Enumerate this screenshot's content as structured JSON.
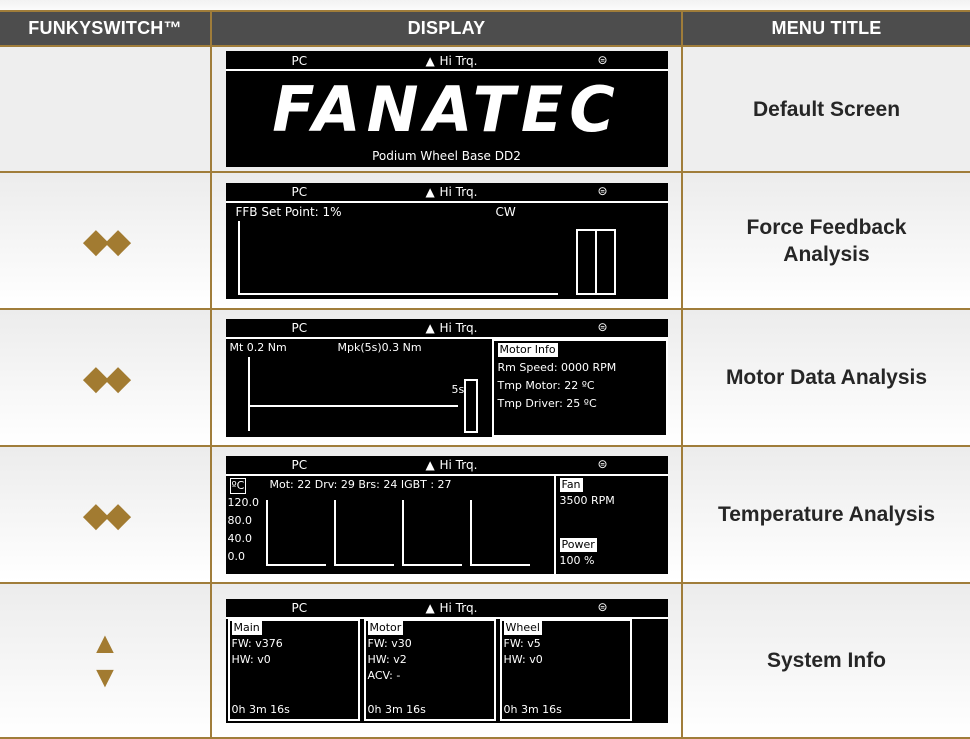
{
  "headers": {
    "funkyswitch": "FUNKYSWITCH™",
    "display": "DISPLAY",
    "menu_title": "MENU TITLE"
  },
  "rows": [
    {
      "control": "",
      "title": "Default Screen",
      "screen": {
        "mode": "PC",
        "trq": "Hi Trq.",
        "logo": "FANATEC",
        "subtitle": "Podium Wheel Base DD2"
      }
    },
    {
      "control": "left-right-arrows",
      "title": "Force Feedback Analysis",
      "screen": {
        "mode": "PC",
        "trq": "Hi Trq.",
        "set_point": "FFB Set Point:  1%",
        "cw": "CW"
      }
    },
    {
      "control": "left-right-arrows",
      "title": "Motor Data Analysis",
      "screen": {
        "mode": "PC",
        "trq": "Hi Trq.",
        "mt": "Mt 0.2 Nm",
        "mpk": "Mpk(5s)0.3 Nm",
        "slider_label": "5s",
        "heading": "Motor Info",
        "rpm": "Rm Speed:  0000 RPM",
        "tmp_motor": "Tmp Motor:  22 ºC",
        "tmp_driver": "Tmp Driver:  25 ºC"
      }
    },
    {
      "control": "left-right-arrows",
      "title": "Temperature Analysis",
      "screen": {
        "mode": "PC",
        "trq": "Hi Trq.",
        "unit": "ºC",
        "temps": "Mot: 22   Drv: 29   Brs: 24   IGBT : 27",
        "y_ticks": [
          "120.0",
          "80.0",
          "40.0",
          "0.0"
        ],
        "fan_label": "Fan",
        "fan_value": "3500 RPM",
        "power_label": "Power",
        "power_value": "100 %"
      }
    },
    {
      "control": "up-down-arrows",
      "title": "System Info",
      "screen": {
        "mode": "PC",
        "trq": "Hi Trq.",
        "col1": {
          "head": "Main",
          "l1": "FW: v376",
          "l2": "HW: v0",
          "l3": "0h 3m 16s"
        },
        "col2": {
          "head": "Motor",
          "l1": "FW: v30",
          "l2": "HW: v2",
          "l3": "ACV: -",
          "l4": "0h 3m 16s"
        },
        "col3": {
          "head": "Wheel",
          "l1": "FW: v5",
          "l2": "HW: v0",
          "l3": "0h 3m 16s"
        }
      }
    }
  ],
  "colors": {
    "accent": "#a07d3a",
    "header_bg": "#4d4d4d"
  }
}
